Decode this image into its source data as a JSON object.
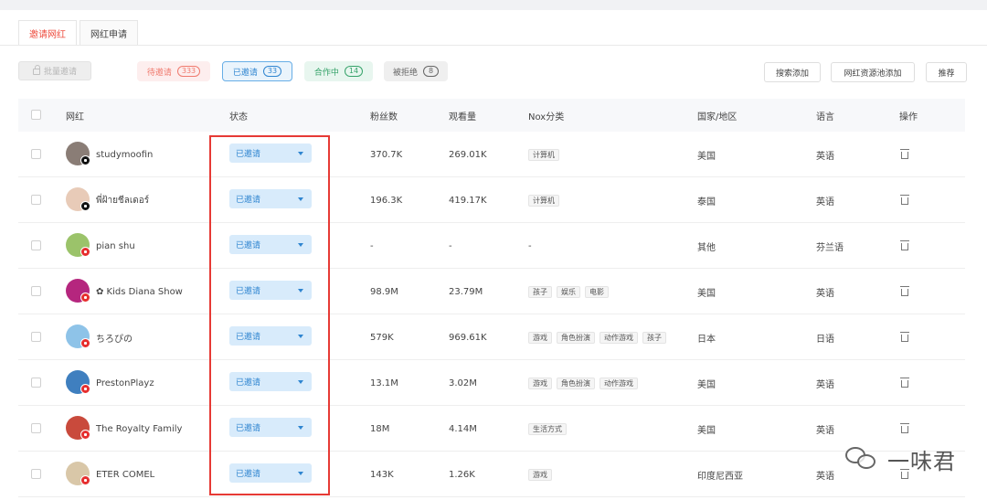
{
  "tabs": [
    {
      "label": "邀请网红",
      "active": true
    },
    {
      "label": "网红申请",
      "active": false
    }
  ],
  "toolbar": {
    "batch_label": "批量邀请",
    "filters": [
      {
        "label": "待邀请",
        "count": "333"
      },
      {
        "label": "已邀请",
        "count": "33"
      },
      {
        "label": "合作中",
        "count": "14"
      },
      {
        "label": "被拒绝",
        "count": "8"
      }
    ],
    "actions": [
      "搜索添加",
      "网红资源池添加",
      "推荐"
    ]
  },
  "table": {
    "headers": [
      "网红",
      "状态",
      "粉丝数",
      "观看量",
      "Nox分类",
      "国家/地区",
      "语言",
      "操作"
    ],
    "rows": [
      {
        "name": "studymoofin",
        "platform": "tiktok",
        "status": "已邀请",
        "followers": "370.7K",
        "views": "269.01K",
        "tags": [
          "计算机"
        ],
        "country": "美国",
        "language": "英语"
      },
      {
        "name": "พี่ฝ้ายชีลเดอร์",
        "platform": "tiktok",
        "status": "已邀请",
        "followers": "196.3K",
        "views": "419.17K",
        "tags": [
          "计算机"
        ],
        "country": "泰国",
        "language": "英语"
      },
      {
        "name": "pian shu",
        "platform": "youtube",
        "status": "已邀请",
        "followers": "-",
        "views": "-",
        "tags_text": "-",
        "tags": [],
        "country": "其他",
        "language": "芬兰语"
      },
      {
        "name": "✿ Kids Diana Show",
        "platform": "youtube",
        "status": "已邀请",
        "followers": "98.9M",
        "views": "23.79M",
        "tags": [
          "孩子",
          "娱乐",
          "电影"
        ],
        "country": "美国",
        "language": "英语"
      },
      {
        "name": "ちろぴの",
        "platform": "youtube",
        "status": "已邀请",
        "followers": "579K",
        "views": "969.61K",
        "tags": [
          "游戏",
          "角色扮演",
          "动作游戏",
          "孩子"
        ],
        "country": "日本",
        "language": "日语"
      },
      {
        "name": "PrestonPlayz",
        "platform": "youtube",
        "status": "已邀请",
        "followers": "13.1M",
        "views": "3.02M",
        "tags": [
          "游戏",
          "角色扮演",
          "动作游戏"
        ],
        "country": "美国",
        "language": "英语"
      },
      {
        "name": "The Royalty Family",
        "platform": "youtube",
        "status": "已邀请",
        "followers": "18M",
        "views": "4.14M",
        "tags": [
          "生活方式"
        ],
        "country": "美国",
        "language": "英语"
      },
      {
        "name": "ETER COMEL",
        "platform": "youtube",
        "status": "已邀请",
        "followers": "143K",
        "views": "1.26K",
        "tags": [
          "游戏"
        ],
        "country": "印度尼西亚",
        "language": "英语"
      }
    ]
  },
  "watermark": {
    "text": "一味君"
  },
  "colors": {
    "accent": "#ee4d3f",
    "status_blue": "#2f85d0",
    "highlight": "#e63a35"
  },
  "icons": {
    "delete": "trash-icon",
    "dropdown": "caret-down-icon",
    "batch": "lock-icon"
  }
}
